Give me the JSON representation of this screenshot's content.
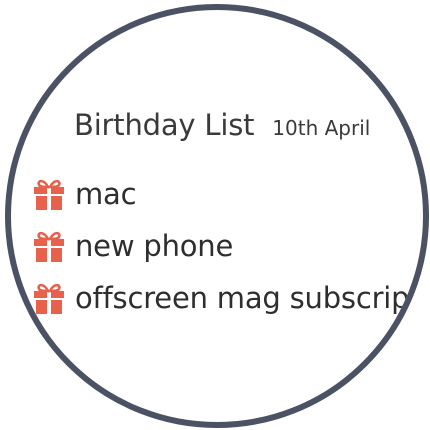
{
  "list": {
    "title": "Birthday List",
    "date": "10th April",
    "icon": "gift-icon",
    "accent_color": "#e8614c",
    "items": [
      {
        "label": "mac"
      },
      {
        "label": "new phone"
      },
      {
        "label": "offscreen mag subscription"
      }
    ]
  },
  "colors": {
    "bezel": "#4a5263",
    "background": "#ffffff",
    "text": "#2e2e2e"
  }
}
